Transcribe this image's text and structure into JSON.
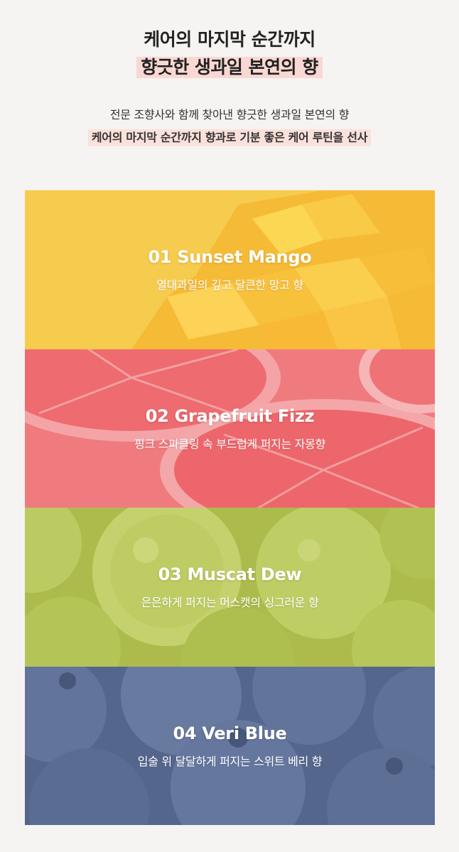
{
  "header": {
    "line1": "케어의 마지막 순간까지",
    "line2": "향긋한 생과일 본연의 향",
    "sub1": "전문 조향사와 함께 찾아낸 향긋한 생과일 본연의 향",
    "sub2": "케어의 마지막 순간까지 향과로 기분 좋은 케어 루틴을 선사"
  },
  "scents": [
    {
      "title": "01 Sunset Mango",
      "desc": "열대과일의 깊고 달큰한 망고 향",
      "color": "#f5c43c"
    },
    {
      "title": "02 Grapefruit Fizz",
      "desc": "핑크 스파클링 속 부드럽게 퍼지는 자몽향",
      "color": "#ee6f72"
    },
    {
      "title": "03 Muscat Dew",
      "desc": "은은하게 퍼지는 머스캣의 싱그러운 향",
      "color": "#b6c44d"
    },
    {
      "title": "04 Veri Blue",
      "desc": "입술 위 달달하게 퍼지는 스위트 베리 향",
      "color": "#56688f"
    }
  ]
}
